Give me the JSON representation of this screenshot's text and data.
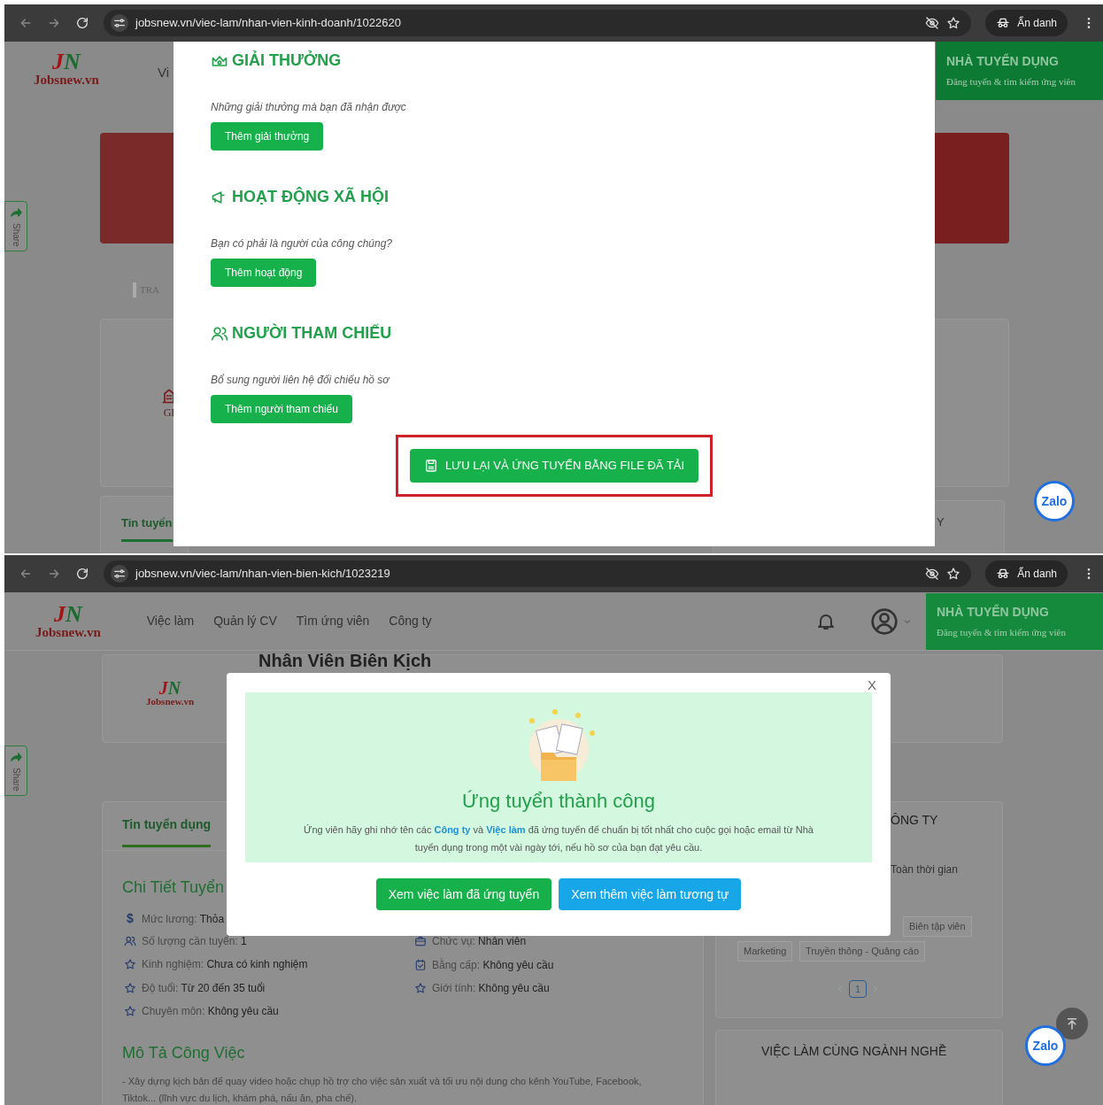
{
  "top_window": {
    "browser": {
      "url": "jobsnew.vn/viec-lam/nhan-vien-kinh-doanh/1022620",
      "profile_label": "Ẩn danh"
    },
    "background": {
      "logo_mark": "JN",
      "logo": "Jobsnew.vn",
      "nav_fragment": "Vi",
      "recruiter": {
        "title": "NHÀ TUYỂN DỤNG",
        "subtitle": "Đăng tuyển & tìm kiếm ứng viên"
      },
      "share_label": "Share",
      "banner_fragment": "TRA",
      "company_fragment": "GI",
      "tab_fragment": "Tin tuyển",
      "side_fragment": "Y",
      "zalo_label": "Zalo"
    },
    "modal": {
      "sections": [
        {
          "kind": "award",
          "heading": "GIẢI THƯỞNG",
          "hint": "Những giải thưởng mà bạn đã nhận được",
          "button": "Thêm giải thưởng"
        },
        {
          "kind": "activity",
          "heading": "HOẠT ĐỘNG XÃ HỘI",
          "hint": "Bạn có phải là người của công chúng?",
          "button": "Thêm hoạt động"
        },
        {
          "kind": "reference",
          "heading": "NGƯỜI THAM CHIẾU",
          "hint": "Bổ sung người liên hệ đối chiếu hồ sơ",
          "button": "Thêm người tham chiếu"
        }
      ],
      "submit": {
        "label": "LƯU LẠI VÀ ỨNG TUYỂN BẰNG FILE ĐÃ TẢI",
        "highlighted": true
      }
    }
  },
  "bottom_window": {
    "browser": {
      "url": "jobsnew.vn/viec-lam/nhan-vien-bien-kich/1023219",
      "profile_label": "Ẩn danh"
    },
    "header": {
      "logo_mark": "JN",
      "logo": "Jobsnew.vn",
      "nav": [
        "Việc làm",
        "Quản lý CV",
        "Tìm ứng viên",
        "Công ty"
      ],
      "recruiter": {
        "title": "NHÀ TUYỂN DỤNG",
        "subtitle": "Đăng tuyển & tìm kiếm ứng viên"
      }
    },
    "job": {
      "title": "Nhân Viên Biên Kịch",
      "logo_mark": "JN",
      "logo": "Jobsnew.vn"
    },
    "share_label": "Share",
    "left_card": {
      "tabs": [
        {
          "label": "Tin tuyển dụng",
          "selected": true
        }
      ],
      "section_title": "Chi Tiết Tuyển",
      "details_left": [
        {
          "kind": "salary",
          "glyph": "$",
          "text": "Mức lương: **Thỏa**"
        },
        {
          "kind": "people",
          "text": "Số lượng cần tuyển: **1**"
        },
        {
          "kind": "star",
          "text": "Kinh nghiệm: **Chưa có kinh nghiệm**"
        },
        {
          "kind": "star",
          "text": "Độ tuổi: **Từ 20 đến 35 tuổi**"
        },
        {
          "kind": "star",
          "text": "Chuyên môn: **Không yêu cầu**"
        }
      ],
      "details_right": [
        {
          "kind": "briefcase",
          "text": "Chức vụ: **Nhân viên**"
        },
        {
          "kind": "certificate",
          "text": "Bằng cấp: **Không yêu cầu**"
        },
        {
          "kind": "star",
          "text": "Giới tính: **Không yêu cầu**"
        }
      ],
      "description_title": "Mô Tả Công Việc",
      "description": "- Xây dựng kịch bản để quay video hoặc chụp hồ trợ cho việc sản xuất và tối ưu nội dung cho kênh YouTube, Facebook, Tiktok... (lĩnh vực du lịch, khám phá, nấu ăn, pha chế)."
    },
    "right_card": {
      "heading_fragment": "ÔNG TY",
      "work_type": "Toàn thời gian",
      "tags": [
        "Biên tập viên",
        "Marketing",
        "Truyền thông - Quảng cáo"
      ],
      "pages": [
        {
          "label": "1",
          "selected": true
        }
      ]
    },
    "related_heading": "VIỆC LÀM CÙNG NGÀNH NGHỀ",
    "zalo_label": "Zalo",
    "modal": {
      "close_label": "X",
      "title": "Ứng tuyển thành công",
      "message": "Ứng viên hãy ghi nhớ tên các **Công ty** và **Việc làm** đã ứng tuyển để chuẩn bị tốt nhất cho cuộc gọi hoặc email từ Nhà tuyển dụng trong một vài ngày tới, nếu hồ sơ của bạn đạt yêu cầu.",
      "buttons": [
        {
          "kind": "primary",
          "label": "Xem việc làm đã ứng tuyển"
        },
        {
          "kind": "secondary",
          "label": "Xem thêm việc làm tương tự"
        }
      ]
    }
  }
}
